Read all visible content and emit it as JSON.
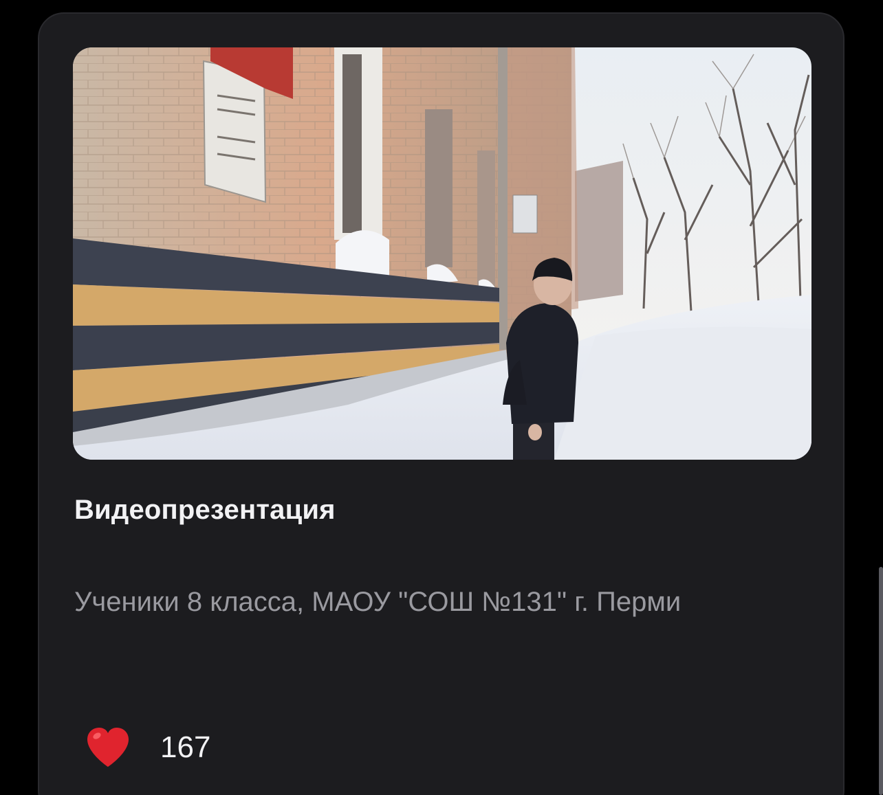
{
  "card": {
    "title": "Видеопрезентация",
    "description": "Ученики 8 класса, МАОУ \"СОШ №131\" г. Перми",
    "likes": {
      "icon": "heart-icon",
      "count": "167"
    }
  },
  "colors": {
    "background": "#000000",
    "card": "#1c1c1f",
    "title": "#f2f2f4",
    "description": "#9a9aa0",
    "heart": "#e0242e"
  }
}
